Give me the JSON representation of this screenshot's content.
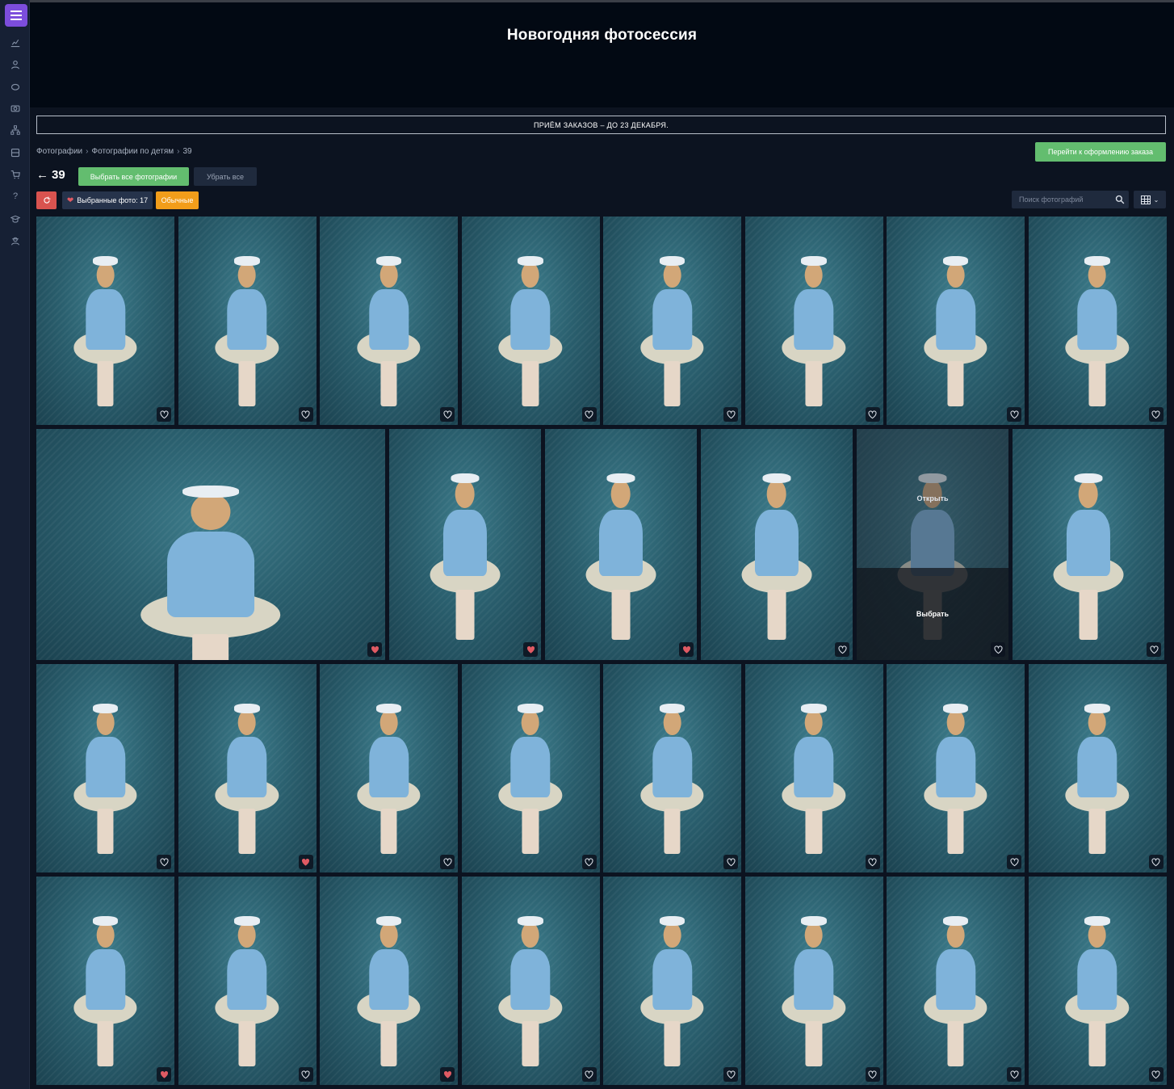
{
  "header": {
    "title": "Новогодняя фотосессия"
  },
  "notice": {
    "text": "ПРИЁМ ЗАКАЗОВ – ДО 23 ДЕКАБРЯ."
  },
  "breadcrumb": {
    "items": [
      "Фотографии",
      "Фотографии по детям",
      "39"
    ]
  },
  "toolbar": {
    "folder_number": "39",
    "select_all_label": "Выбрать все фотографии",
    "clear_all_label": "Убрать все",
    "checkout_label": "Перейти к оформлению заказа",
    "favorites_label": "Выбранные фото: 17",
    "regular_label": "Обычные",
    "search_placeholder": "Поиск фотографий"
  },
  "hover": {
    "open_label": "Открыть",
    "select_label": "Выбрать"
  },
  "colors": {
    "accent": "#7c4ddc",
    "green": "#63bd6f",
    "orange": "#f29d1a",
    "red": "#d9534f",
    "heart": "#e05a63"
  },
  "sidebar": {
    "icons": [
      "menu-icon",
      "chart-icon",
      "people-icon",
      "piggy-bank-icon",
      "camera-icon",
      "hierarchy-icon",
      "storage-icon",
      "cart-icon",
      "help-icon",
      "graduation-icon",
      "user-secret-icon"
    ]
  },
  "photos": {
    "row1": [
      false,
      false,
      false,
      false,
      false,
      false,
      false,
      false
    ],
    "row2": [
      true,
      true,
      true,
      false,
      false,
      false
    ],
    "row3": [
      false,
      true,
      false,
      false,
      false,
      false,
      false,
      false
    ],
    "row4": [
      true,
      false,
      true,
      false,
      false,
      false,
      false,
      false
    ]
  }
}
